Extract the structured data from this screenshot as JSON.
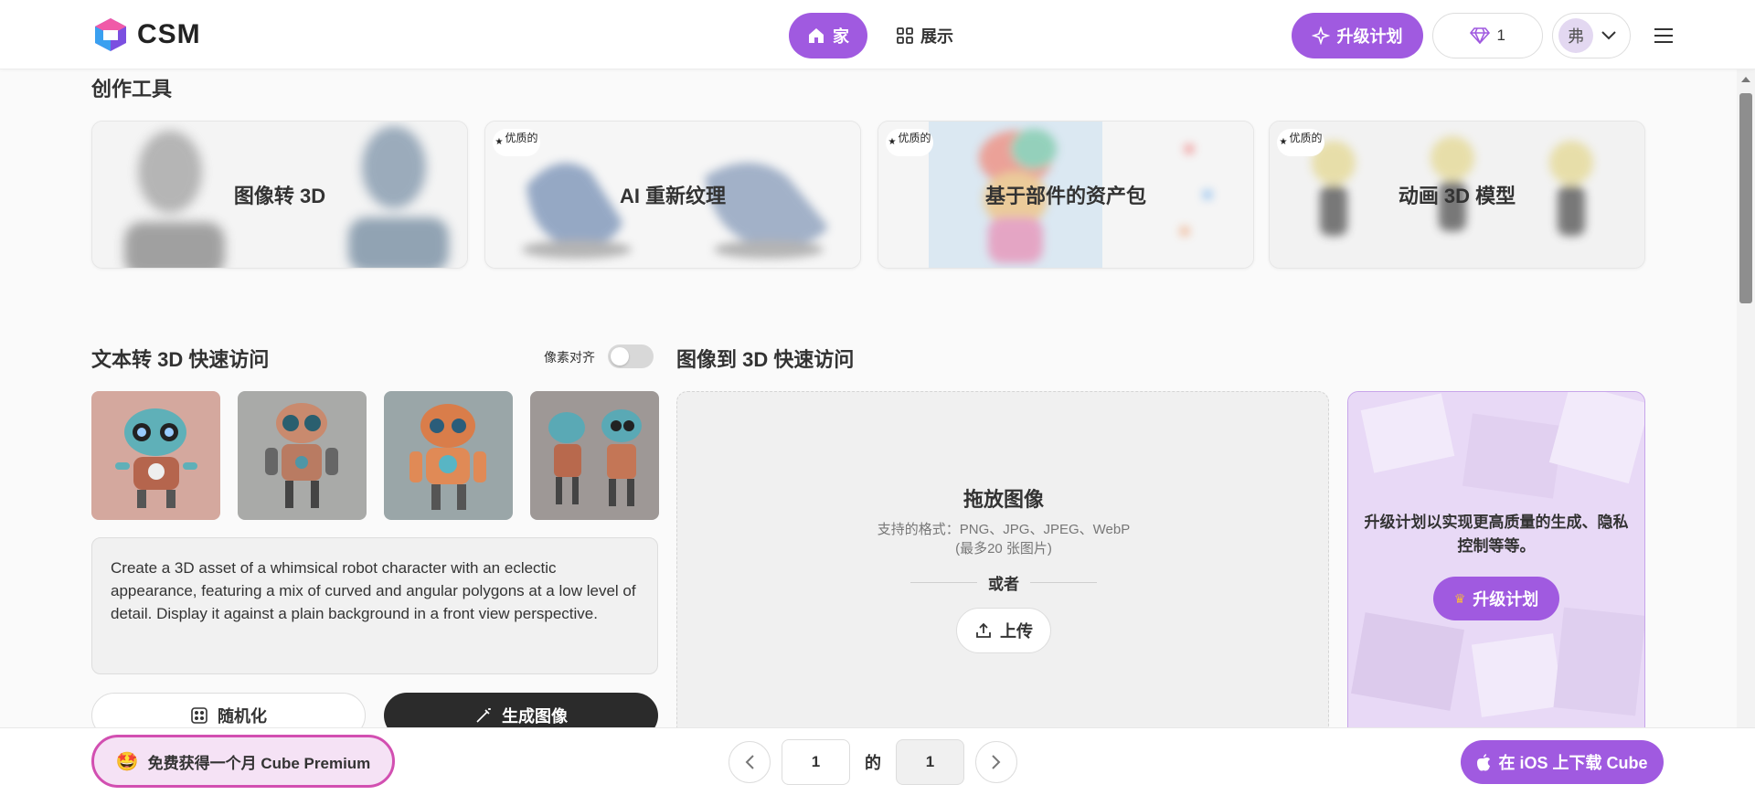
{
  "header": {
    "logo_text": "CSM",
    "nav": {
      "home": "家",
      "showcase": "展示"
    },
    "upgrade": "升级计划",
    "credits": "1",
    "avatar_initial": "弗"
  },
  "tools": {
    "title": "创作工具",
    "badge_text": "优质的",
    "cards": [
      {
        "label": "图像转 3D",
        "premium": false
      },
      {
        "label": "AI 重新纹理",
        "premium": true
      },
      {
        "label": "基于部件的资产包",
        "premium": true
      },
      {
        "label": "动画 3D 模型",
        "premium": true
      }
    ]
  },
  "text_to_3d": {
    "title": "文本转 3D 快速访问",
    "toggle_label": "像素对齐",
    "toggle_on": false,
    "prompt": "Create a 3D asset of a whimsical robot character with an eclectic appearance, featuring a mix of curved and angular polygons at a low level of detail. Display it against a plain background in a front view perspective.",
    "randomize": "随机化",
    "generate": "生成图像"
  },
  "image_to_3d": {
    "title": "图像到 3D 快速访问",
    "drop_title": "拖放图像",
    "formats": "支持的格式：PNG、JPG、JPEG、WebP",
    "limit": "(最多20 张图片)",
    "or": "或者",
    "upload": "上传"
  },
  "promo": {
    "text": "升级计划以实现更高质量的生成、隐私控制等等。",
    "button": "升级计划"
  },
  "bottom": {
    "premium_offer": "免费获得一个月 Cube Premium",
    "page_current": "1",
    "page_of": "的",
    "page_total": "1",
    "ios": "在 iOS 上下载 Cube"
  },
  "colors": {
    "accent": "#a05ae0",
    "premium_border": "#d24fb1",
    "dark_button": "#2b2b2b"
  }
}
